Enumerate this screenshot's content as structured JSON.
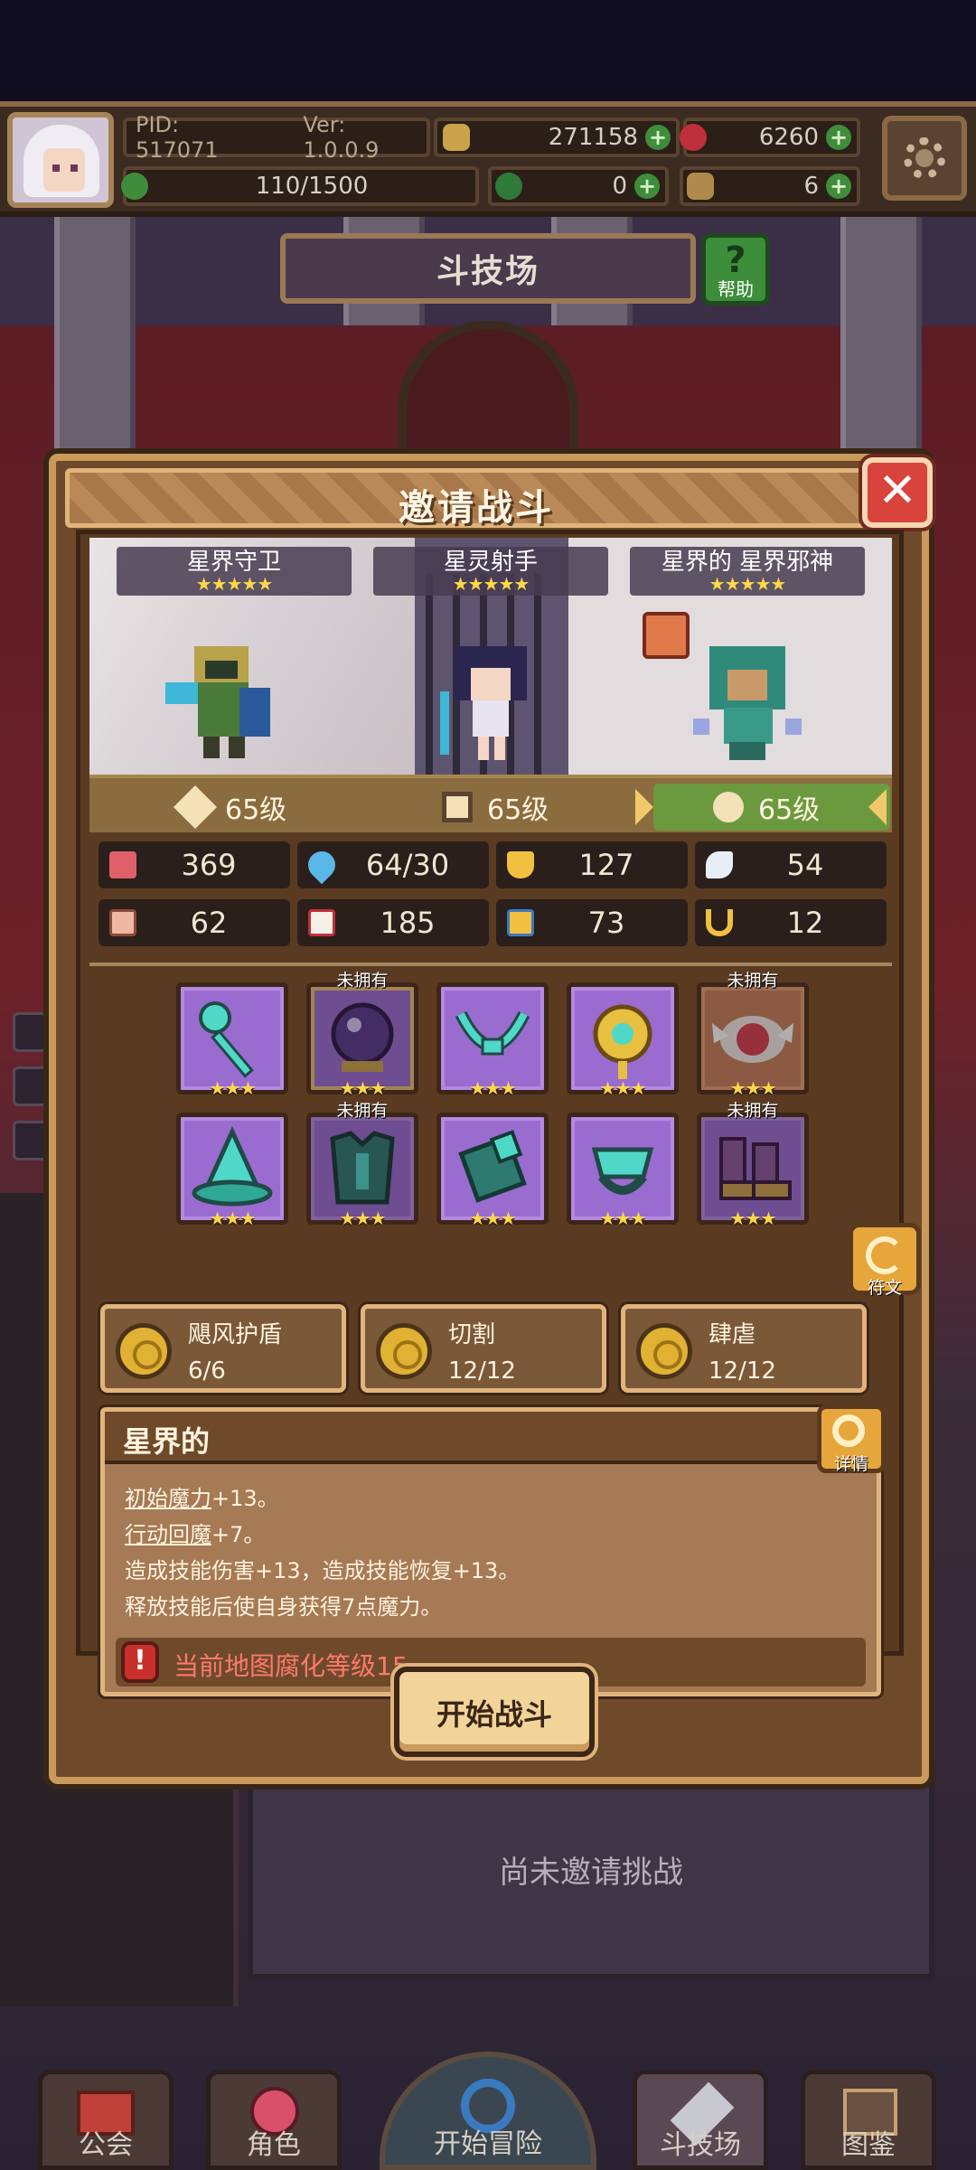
{
  "hud": {
    "pid": "PID: 517071",
    "version": "Ver: 1.0.0.9",
    "gold": "271158",
    "gems": "6260",
    "exp": "110/1500",
    "clover": "0",
    "keys": "6"
  },
  "arena": {
    "title": "斗技场",
    "help_label": "帮助"
  },
  "dialog": {
    "title": "邀请战斗",
    "close_symbol": "✕",
    "heroes": [
      {
        "name": "星界守卫",
        "stars": "★★★★★"
      },
      {
        "name": "星灵射手",
        "stars": "★★★★★"
      },
      {
        "name": "星界的 星界邪神",
        "stars": "★★★★★"
      }
    ],
    "levels": [
      "65级",
      "65级",
      "65级"
    ],
    "stats": [
      "369",
      "64/30",
      "127",
      "54",
      "62",
      "185",
      "73",
      "12"
    ],
    "equipment": [
      {
        "stars": "★★★",
        "unowned": ""
      },
      {
        "stars": "★★★",
        "unowned": "未拥有"
      },
      {
        "stars": "★★★",
        "unowned": ""
      },
      {
        "stars": "★★★",
        "unowned": ""
      },
      {
        "stars": "★★★",
        "unowned": "未拥有"
      },
      {
        "stars": "★★★",
        "unowned": ""
      },
      {
        "stars": "★★★",
        "unowned": "未拥有"
      },
      {
        "stars": "★★★",
        "unowned": ""
      },
      {
        "stars": "★★★",
        "unowned": ""
      },
      {
        "stars": "★★★",
        "unowned": "未拥有"
      }
    ],
    "rune_label": "符文",
    "skills": [
      {
        "name": "飓风护盾",
        "count": "6/6"
      },
      {
        "name": "切割",
        "count": "12/12"
      },
      {
        "name": "肆虐",
        "count": "12/12"
      }
    ],
    "set": {
      "name": "星界的",
      "detail_label": "详情",
      "line1_key": "初始魔力",
      "line1_val": "+13。",
      "line2_key": "行动回魔",
      "line2_val": "+7。",
      "line3": "造成技能伤害+13，造成技能恢复+13。",
      "line4": "释放技能后使自身获得7点魔力。",
      "warning": "当前地图腐化等级15",
      "warning_icon": "!"
    },
    "start_label": "开始战斗"
  },
  "background": {
    "not_invited": "尚未邀请挑战"
  },
  "nav": {
    "guild": "公会",
    "role": "角色",
    "adventure": "开始冒险",
    "arena": "斗技场",
    "codex": "图鉴"
  },
  "colors": {
    "gold_coin": "#c9a24a",
    "gem_red": "#c0303a",
    "plus_green": "#3f8d3a",
    "purple_frame": "#9a6cd0",
    "orange_frame": "#c88056",
    "warning_red": "#ff7a6a"
  },
  "icons": {
    "hud": [
      "avatar",
      "gold-coin-icon",
      "red-gem-icon",
      "clover-icon",
      "key-icon",
      "settings-gear-icon"
    ],
    "stats": [
      "heart-icon",
      "mana-drop-icon",
      "shield-icon",
      "wing-icon",
      "fist-icon",
      "book-icon",
      "boot-icon",
      "horseshoe-icon"
    ]
  }
}
